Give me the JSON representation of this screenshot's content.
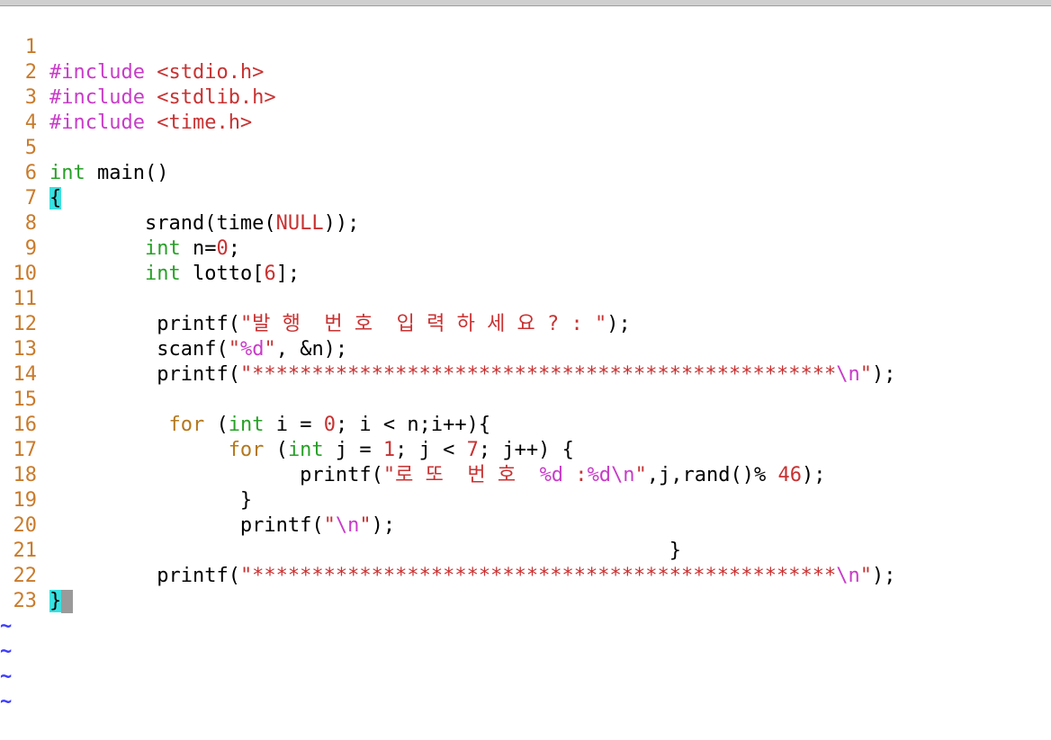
{
  "editor": {
    "line_numbers": [
      "1",
      "2",
      "3",
      "4",
      "5",
      "6",
      "7",
      "8",
      "9",
      "10",
      "11",
      "12",
      "13",
      "14",
      "15",
      "16",
      "17",
      "18",
      "19",
      "20",
      "21",
      "22",
      "23"
    ],
    "tilde": "~",
    "tokens": {
      "l1_a": "#include ",
      "l1_b": "<stdio.h>",
      "l2_a": "#include ",
      "l2_b": "<stdlib.h>",
      "l3_a": "#include ",
      "l3_b": "<time.h>",
      "l5_a": "int",
      "l5_b": " main()",
      "l6_a": "{",
      "l7_indent": "        ",
      "l7_a": "srand(time(",
      "l7_b": "NULL",
      "l7_c": "));",
      "l8_indent": "        ",
      "l8_a": "int",
      "l8_b": " n=",
      "l8_c": "0",
      "l8_d": ";",
      "l9_indent": "        ",
      "l9_a": "int",
      "l9_b": " lotto[",
      "l9_c": "6",
      "l9_d": "];",
      "l11_indent": "         ",
      "l11_a": "printf(",
      "l11_b": "\"발 행  번 호  입 력 하 세 요 ? : \"",
      "l11_c": ");",
      "l12_indent": "         ",
      "l12_a": "scanf(",
      "l12_b": "\"",
      "l12_c": "%d",
      "l12_d": "\"",
      "l12_e": ", &n);",
      "l13_indent": "         ",
      "l13_a": "printf(",
      "l13_b": "\"*************************************************",
      "l13_c": "\\n",
      "l13_d": "\"",
      "l13_e": ");",
      "l15_indent": "          ",
      "l15_a": "for",
      "l15_b": " (",
      "l15_c": "int",
      "l15_d": " i = ",
      "l15_e": "0",
      "l15_f": "; i < n;i++){",
      "l16_indent": "               ",
      "l16_a": "for",
      "l16_b": " (",
      "l16_c": "int",
      "l16_d": " j = ",
      "l16_e": "1",
      "l16_f": "; j < ",
      "l16_g": "7",
      "l16_h": "; j++) {",
      "l17_indent": "                     ",
      "l17_a": "printf(",
      "l17_b": "\"로 또  번 호  ",
      "l17_c": "%d",
      "l17_d": " :",
      "l17_e": "%d",
      "l17_f": "\\n",
      "l17_g": "\"",
      "l17_h": ",j,rand()% ",
      "l17_i": "46",
      "l17_j": ");",
      "l18_indent": "                ",
      "l18_a": "}",
      "l19_indent": "                ",
      "l19_a": "printf(",
      "l19_b": "\"",
      "l19_c": "\\n",
      "l19_d": "\"",
      "l19_e": ");",
      "l20_indent": "                                                    ",
      "l20_a": "}",
      "l21_indent": "         ",
      "l21_a": "printf(",
      "l21_b": "\"*************************************************",
      "l21_c": "\\n",
      "l21_d": "\"",
      "l21_e": ");",
      "l22_a": "}"
    },
    "colors": {
      "line_number": "#c97b2c",
      "preprocessor": "#c83cc8",
      "string": "#c83232",
      "type": "#28a028",
      "keyword": "#b4781e",
      "brace_highlight": "#39e0e0",
      "tilde": "#3c3cff"
    }
  }
}
